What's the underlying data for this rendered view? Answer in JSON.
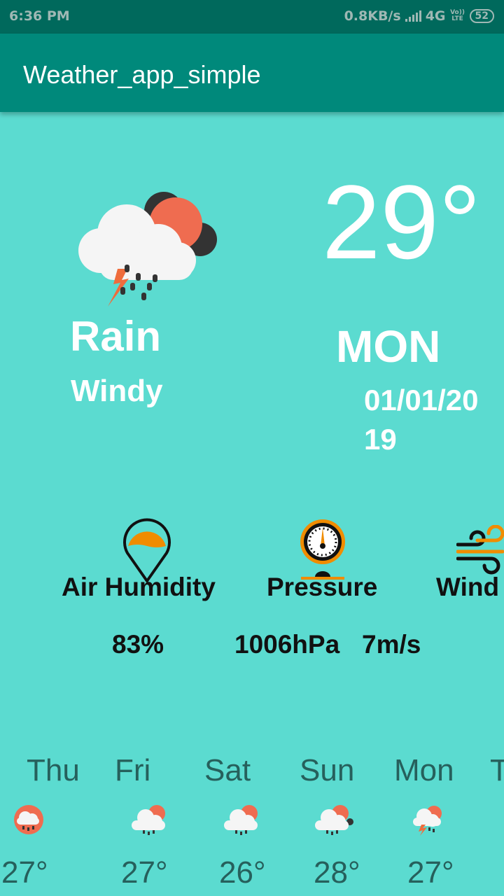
{
  "status_bar": {
    "time": "6:36 PM",
    "net_speed": "0.8KB/s",
    "network": "4G",
    "volte": "Vo)) LTE",
    "battery": "52"
  },
  "app_bar": {
    "title": "Weather_app_simple"
  },
  "current": {
    "temperature": "29°",
    "condition": "Rain",
    "description": "Windy",
    "day": "MON",
    "date_line1": "01/01/20",
    "date_line2": "19",
    "icon": "cloud-sun-thunder-rain-icon"
  },
  "stats": {
    "humidity_label": "Air Humidity",
    "humidity_value": "83%",
    "pressure_label": "Pressure",
    "pressure_value": "1006hPa",
    "wind_label": "Wind",
    "wind_value": "7m/s"
  },
  "forecast": [
    {
      "day": "Thu",
      "temp": "27°",
      "icon": "cloud-rain-icon"
    },
    {
      "day": "Fri",
      "temp": "27°",
      "icon": "cloud-sun-rain-icon"
    },
    {
      "day": "Sat",
      "temp": "26°",
      "icon": "cloud-sun-rain-icon"
    },
    {
      "day": "Sun",
      "temp": "28°",
      "icon": "cloud-sun-rain-icon"
    },
    {
      "day": "Mon",
      "temp": "27°",
      "icon": "cloud-sun-thunder-icon"
    },
    {
      "day": "T",
      "temp": "",
      "icon": ""
    }
  ],
  "colors": {
    "background": "#5bdbd0",
    "status_bar": "#00695c",
    "app_bar": "#00897b",
    "accent_orange": "#f08c00",
    "forecast_text": "#26605c"
  }
}
